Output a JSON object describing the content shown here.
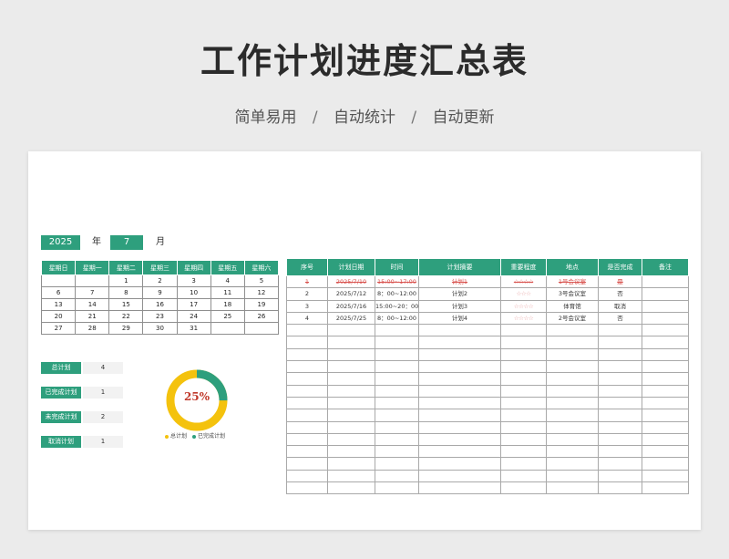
{
  "header": {
    "title": "工作计划进度汇总表",
    "subtitle_parts": [
      "简单易用",
      "自动统计",
      "自动更新"
    ],
    "separator": "/"
  },
  "date": {
    "year": "2025",
    "year_label": "年",
    "month": "7",
    "month_label": "月"
  },
  "calendar": {
    "weekdays": [
      "星期日",
      "星期一",
      "星期二",
      "星期三",
      "星期四",
      "星期五",
      "星期六"
    ],
    "weeks": [
      [
        "",
        "",
        "1",
        "2",
        "3",
        "4",
        "5"
      ],
      [
        "6",
        "7",
        "8",
        "9",
        "10",
        "11",
        "12"
      ],
      [
        "13",
        "14",
        "15",
        "16",
        "17",
        "18",
        "19"
      ],
      [
        "20",
        "21",
        "22",
        "23",
        "24",
        "25",
        "26"
      ],
      [
        "27",
        "28",
        "29",
        "30",
        "31",
        "",
        ""
      ]
    ]
  },
  "stats": [
    {
      "label": "总计划",
      "value": "4"
    },
    {
      "label": "已完成计划",
      "value": "1"
    },
    {
      "label": "未完成计划",
      "value": "2"
    },
    {
      "label": "取消计划",
      "value": "1"
    }
  ],
  "chart": {
    "percent_label": "25%",
    "completed_fraction": 0.25,
    "legend": [
      "总计划",
      "已完成计划"
    ],
    "colors": {
      "total": "#f4c20d",
      "completed": "#2e9f7d"
    }
  },
  "plan_table": {
    "columns": [
      "序号",
      "计划日期",
      "时间",
      "计划摘要",
      "重要程度",
      "地点",
      "是否完成",
      "备注"
    ],
    "rows": [
      {
        "no": "1",
        "date": "2025/7/10",
        "time": "15:00~17:00",
        "summary": "计划1",
        "importance": "☆☆☆☆",
        "place": "1号会议室",
        "done": "是",
        "note": "",
        "completed": true
      },
      {
        "no": "2",
        "date": "2025/7/12",
        "time": "8：00~12:00",
        "summary": "计划2",
        "importance": "☆☆☆",
        "place": "3号会议室",
        "done": "否",
        "note": "",
        "completed": false
      },
      {
        "no": "3",
        "date": "2025/7/16",
        "time": "15:00~20：00",
        "summary": "计划3",
        "importance": "☆☆☆☆",
        "place": "体育馆",
        "done": "取消",
        "note": "",
        "completed": false
      },
      {
        "no": "4",
        "date": "2025/7/25",
        "time": "8：00~12:00",
        "summary": "计划4",
        "importance": "☆☆☆☆",
        "place": "2号会议室",
        "done": "否",
        "note": "",
        "completed": false
      }
    ],
    "empty_rows": 14
  },
  "colors": {
    "accent": "#2e9f7d",
    "donut_main": "#f4c20d",
    "percent_text": "#c0392b"
  }
}
